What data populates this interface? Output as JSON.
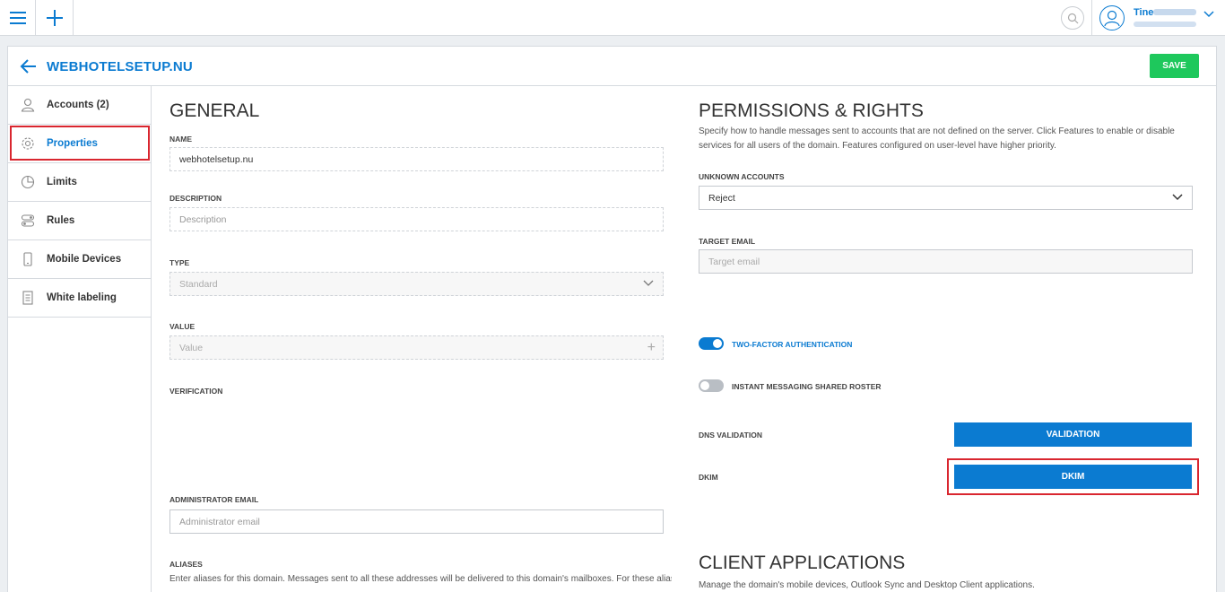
{
  "topbar": {
    "user_name": "Tine"
  },
  "header": {
    "domain_title": "WEBHOTELSETUP.NU",
    "save_label": "SAVE"
  },
  "sidebar": {
    "items": [
      {
        "label": "Accounts (2)",
        "icon": "user-icon"
      },
      {
        "label": "Properties",
        "icon": "gear-icon"
      },
      {
        "label": "Limits",
        "icon": "pie-chart-icon"
      },
      {
        "label": "Rules",
        "icon": "toggles-icon"
      },
      {
        "label": "Mobile Devices",
        "icon": "mobile-icon"
      },
      {
        "label": "White labeling",
        "icon": "document-icon"
      }
    ]
  },
  "general": {
    "title": "GENERAL",
    "name_label": "NAME",
    "name_value": "webhotelsetup.nu",
    "description_label": "DESCRIPTION",
    "description_placeholder": "Description",
    "type_label": "TYPE",
    "type_value": "Standard",
    "value_label": "VALUE",
    "value_placeholder": "Value",
    "verification_label": "VERIFICATION",
    "admin_email_label": "ADMINISTRATOR EMAIL",
    "admin_email_placeholder": "Administrator email",
    "aliases_label": "ALIASES",
    "aliases_desc": "Enter aliases for this domain. Messages sent to all these addresses will be delivered to this domain's mailboxes. For these aliases you"
  },
  "permissions": {
    "title": "PERMISSIONS & RIGHTS",
    "desc": "Specify how to handle messages sent to accounts that are not defined on the server. Click Features to enable or disable services for all users of the domain. Features configured on user-level have higher priority.",
    "unknown_accounts_label": "UNKNOWN ACCOUNTS",
    "unknown_accounts_value": "Reject",
    "target_email_label": "TARGET EMAIL",
    "target_email_placeholder": "Target email",
    "two_factor_label": "TWO-FACTOR AUTHENTICATION",
    "two_factor_on": true,
    "im_roster_label": "INSTANT MESSAGING SHARED ROSTER",
    "im_roster_on": false,
    "dns_validation_label": "DNS VALIDATION",
    "validation_button": "VALIDATION",
    "dkim_label": "DKIM",
    "dkim_button": "DKIM"
  },
  "client_apps": {
    "title": "CLIENT APPLICATIONS",
    "desc": "Manage the domain's mobile devices, Outlook Sync and Desktop Client applications."
  },
  "colors": {
    "accent": "#0b7bd1",
    "save": "#1ec85c",
    "highlight": "#d9262f"
  }
}
